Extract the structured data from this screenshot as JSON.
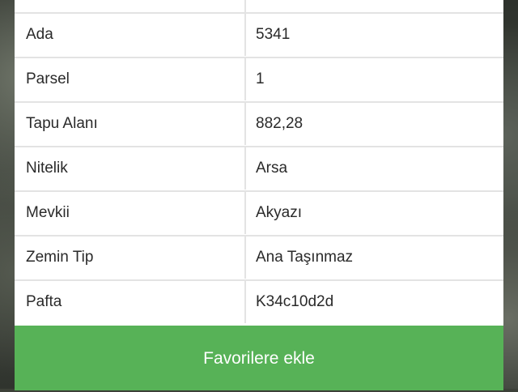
{
  "table": {
    "rows": [
      {
        "label": "",
        "value": ""
      },
      {
        "label": "Ada",
        "value": "5341"
      },
      {
        "label": "Parsel",
        "value": "1"
      },
      {
        "label": "Tapu Alanı",
        "value": "882,28"
      },
      {
        "label": "Nitelik",
        "value": "Arsa"
      },
      {
        "label": "Mevkii",
        "value": "Akyazı"
      },
      {
        "label": "Zemin Tip",
        "value": "Ana Taşınmaz"
      },
      {
        "label": "Pafta",
        "value": "K34c10d2d"
      }
    ]
  },
  "actions": {
    "favorite_label": "Favorilere ekle"
  },
  "colors": {
    "button": "#57b257",
    "row_border": "#e3e3e3"
  }
}
